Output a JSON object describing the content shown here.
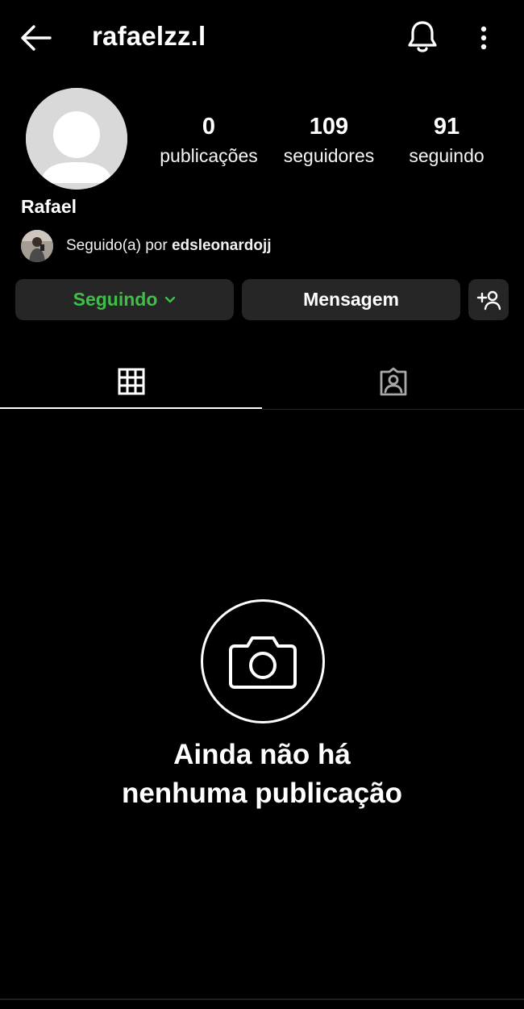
{
  "header": {
    "username": "rafaelzz.l",
    "back_icon": "arrow-left-icon",
    "bell_icon": "bell-icon",
    "more_icon": "more-vertical-icon"
  },
  "profile": {
    "display_name": "Rafael",
    "stats": {
      "posts": {
        "value": "0",
        "label": "publicações"
      },
      "followers": {
        "value": "109",
        "label": "seguidores"
      },
      "following": {
        "value": "91",
        "label": "seguindo"
      }
    },
    "mutual": {
      "prefix": "Seguido(a) por ",
      "user": "edsleonardojj"
    }
  },
  "actions": {
    "following_label": "Seguindo",
    "message_label": "Mensagem",
    "add_user_icon": "add-user-icon"
  },
  "tabs": [
    {
      "name": "grid",
      "icon": "grid-icon",
      "active": true
    },
    {
      "name": "tagged",
      "icon": "tagged-user-icon",
      "active": false
    }
  ],
  "empty_state": {
    "icon": "camera-icon",
    "line1": "Ainda não há",
    "line2": "nenhuma publicação"
  },
  "colors": {
    "background": "#000000",
    "button_bg": "#262626",
    "following_green": "#3fbf4a",
    "avatar_placeholder": "#d9d9d9"
  }
}
